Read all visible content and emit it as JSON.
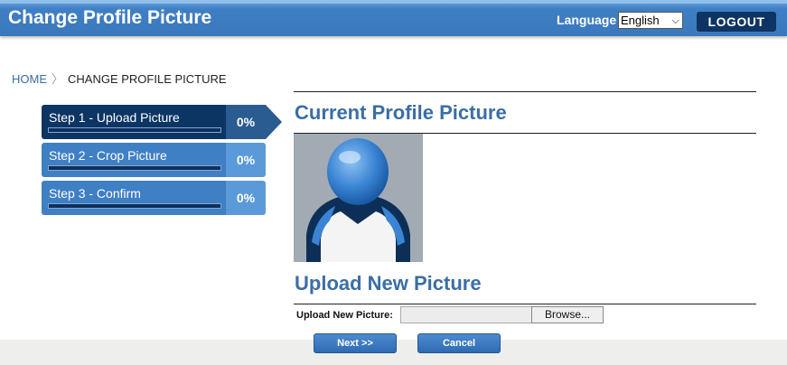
{
  "header": {
    "title": "Change Profile Picture",
    "language_label": "Language",
    "language_selected": "English",
    "logout_label": "LOGOUT"
  },
  "breadcrumb": {
    "home": "HOME",
    "current": "CHANGE PROFILE PICTURE"
  },
  "steps": [
    {
      "label": "Step 1 - Upload Picture",
      "percent_text": "0%",
      "progress": 0,
      "active": true
    },
    {
      "label": "Step 2 - Crop Picture",
      "percent_text": "0%",
      "progress": 0,
      "active": false
    },
    {
      "label": "Step 3 - Confirm",
      "percent_text": "0%",
      "progress": 0,
      "active": false
    }
  ],
  "current_picture": {
    "title": "Current Profile Picture"
  },
  "upload": {
    "title": "Upload New Picture",
    "field_label": "Upload New Picture:",
    "file_value": "",
    "browse_label": "Browse..."
  },
  "actions": {
    "next_label": "Next >>",
    "cancel_label": "Cancel"
  },
  "colors": {
    "header_blue": "#3f7fc4",
    "active_step": "#0d3564",
    "title_blue": "#3b6ea5",
    "logout_bg": "#0e3463"
  }
}
